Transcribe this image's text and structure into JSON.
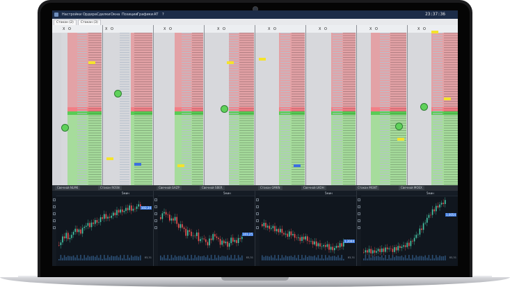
{
  "titlebar": {
    "menu": [
      "Настройки",
      "Ордера",
      "Сделки",
      "Окна",
      "Позиции",
      "Графики",
      "АТ",
      "?"
    ],
    "clock": "23:37:36"
  },
  "tabs": [
    "Стакан (2)",
    "Стакан (3)"
  ],
  "ladders": [
    "A",
    "B",
    "C",
    "D",
    "E",
    "F",
    "G",
    "H"
  ],
  "ladder_controls": [
    "X",
    "O"
  ],
  "chart_tabs": [
    "Свечной NLMK",
    "Стакан ROSN",
    "Свечной GAZP",
    "Свечной SBER",
    "Стакан GMKN",
    "Свечной LKOH",
    "Стакан MGNT",
    "Свечной MOEX"
  ],
  "charts": [
    {
      "timeframe": "5мин",
      "price": "83,31",
      "tag": "102,34"
    },
    {
      "timeframe": "5мин",
      "price": "83,31",
      "tag": "101,25"
    },
    {
      "timeframe": "5мин",
      "price": "83,31",
      "tag": "1,2044"
    },
    {
      "timeframe": "5мин",
      "price": "83,31",
      "tag": "1,0054"
    }
  ],
  "colors": {
    "ask": "#e3a2a6",
    "bid": "#a6dc9c",
    "candle_up": "#46c9a8",
    "candle_down": "#f05050"
  }
}
